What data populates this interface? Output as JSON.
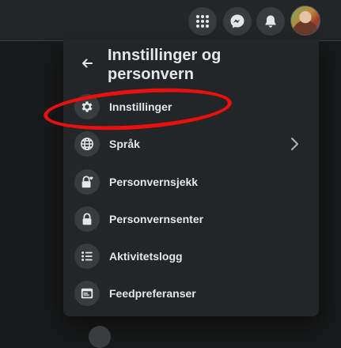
{
  "header": {
    "title": "Innstillinger og personvern"
  },
  "top_bar": {
    "buttons": [
      "menu-grid-icon",
      "messenger-icon",
      "notifications-bell-icon",
      "profile-avatar"
    ]
  },
  "menu": {
    "items": [
      {
        "label": "Innstillinger",
        "icon": "gear-icon"
      },
      {
        "label": "Språk",
        "icon": "globe-icon",
        "has_submenu": true
      },
      {
        "label": "Personvernsjekk",
        "icon": "lock-heart-icon"
      },
      {
        "label": "Personvernsenter",
        "icon": "lock-icon"
      },
      {
        "label": "Aktivitetslogg",
        "icon": "list-icon"
      },
      {
        "label": "Feedpreferanser",
        "icon": "feed-icon"
      }
    ]
  },
  "annotation": {
    "color": "#e8110f",
    "target": "Innstillinger"
  }
}
